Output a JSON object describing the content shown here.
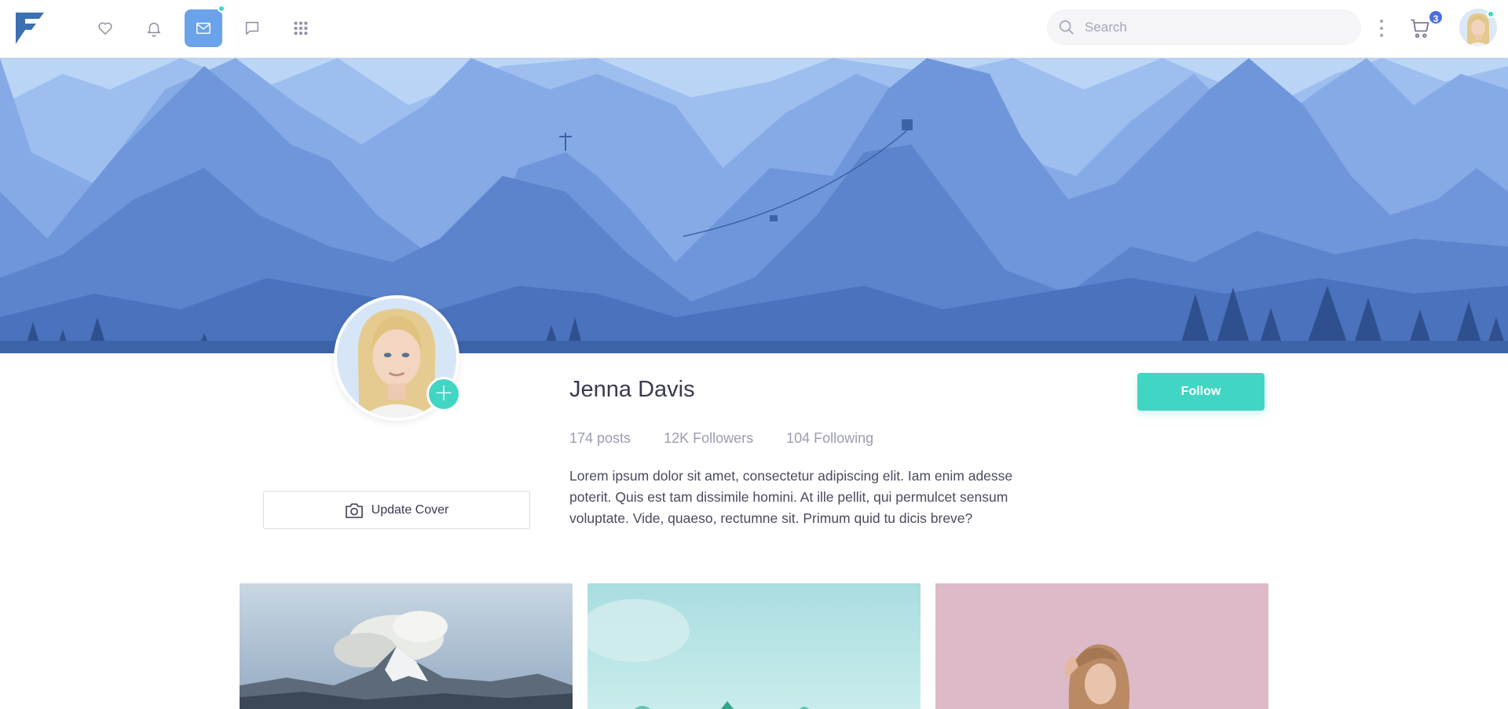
{
  "navbar": {
    "icons": [
      "logo-icon",
      "heart-icon",
      "bell-icon",
      "mail-icon",
      "chat-icon",
      "apps-grid-icon"
    ],
    "active_icon": "mail-icon",
    "search": {
      "placeholder": "Search"
    },
    "cart": {
      "icon": "cart-icon",
      "count": "3"
    },
    "accent_color": "#6ba3ea",
    "status_color": "#41d6c3"
  },
  "profile": {
    "name": "Jenna Davis",
    "stats": {
      "posts": "174 posts",
      "followers": "12K Followers",
      "following": "104 Following"
    },
    "bio": "Lorem ipsum dolor sit amet, consectetur adipiscing elit. Iam enim adesse poterit. Quis est tam dissimile homini. At ille pellit, qui permulcet sensum voluptate. Vide, quaeso, rectumne sit. Primum quid tu dicis breve?",
    "follow_label": "Follow",
    "update_cover_label": "Update Cover",
    "add_icon": "plus-icon",
    "follow_color": "#41d6c3"
  },
  "gallery": {
    "tiles": [
      "mountain-photo",
      "teal-landscape-photo",
      "woman-portrait-photo"
    ]
  }
}
